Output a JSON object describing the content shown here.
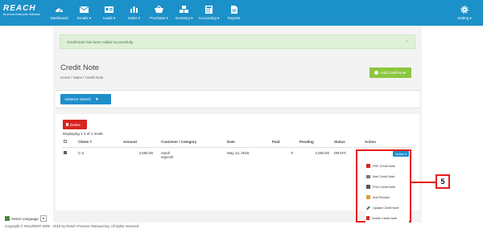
{
  "brand": {
    "logo": "REACH",
    "tagline": "Business Enterprise Software"
  },
  "nav": {
    "items": [
      {
        "label": "Dashboard",
        "icon": "dashboard-icon"
      },
      {
        "label": "Emails ▾",
        "icon": "envelope-icon"
      },
      {
        "label": "Leads ▾",
        "icon": "card-icon"
      },
      {
        "label": "Sales ▾",
        "icon": "bar-chart-icon"
      },
      {
        "label": "Purchase ▾",
        "icon": "basket-icon"
      },
      {
        "label": "Inventory ▾",
        "icon": "boxes-icon"
      },
      {
        "label": "Accounting ▾",
        "icon": "calculator-icon"
      },
      {
        "label": "Reports",
        "icon": "document-icon"
      }
    ],
    "settings_label": "Setting ▾"
  },
  "alert": {
    "message": "Credit Note has been Added successfully.",
    "close": "×"
  },
  "page": {
    "title": "Credit Note",
    "breadcrumb": "Home  /  Sales  /  Credit Note",
    "add_button": "Add Credit Note",
    "advance_search": "Advance Search"
  },
  "table_panel": {
    "delete_button": "Delete",
    "displaying": "Displaying 1-1 of 1 result.",
    "columns": [
      "",
      "CNote #",
      "Amount",
      "Customer / Category",
      "Date",
      "Paid",
      "Pending",
      "Status",
      "Action"
    ],
    "rows": [
      {
        "cnote": "C 6",
        "amount": "2,500.00",
        "customer": "reach",
        "category": "v/gocsh",
        "date": "May 13, 2016",
        "paid": "0",
        "pending": "2,500.00",
        "status": "DRAFT",
        "action": "Action ▾"
      }
    ]
  },
  "action_menu": [
    {
      "label": "PDF Credit Note",
      "icon": "pdf-icon",
      "color": "#d9231f"
    },
    {
      "label": "Mail Credit Note",
      "icon": "mail-icon",
      "color": "#777777"
    },
    {
      "label": "Print Credit Note",
      "icon": "print-icon",
      "color": "#555555"
    },
    {
      "label": "Add Receipt",
      "icon": "receipt-icon",
      "color": "#e0a030"
    },
    {
      "label": "Update Credit Note",
      "icon": "edit-icon",
      "color": "#3a8a3a"
    },
    {
      "label": "Delete Credit Note",
      "icon": "trash-icon",
      "color": "#d9231f"
    }
  ],
  "callout": {
    "number": "5"
  },
  "footer": {
    "language_label": "Select Language",
    "language_arrow": "▾",
    "copyright": "Copyright © ReachERP 2005 - 2016 by Reach Process Outsourcing. All rights reserved."
  },
  "colors": {
    "nav_bg": "#1c90c8",
    "primary": "#1f8fcc",
    "success": "#8dc63f",
    "danger": "#d9231f",
    "highlight": "#e81a1a"
  }
}
